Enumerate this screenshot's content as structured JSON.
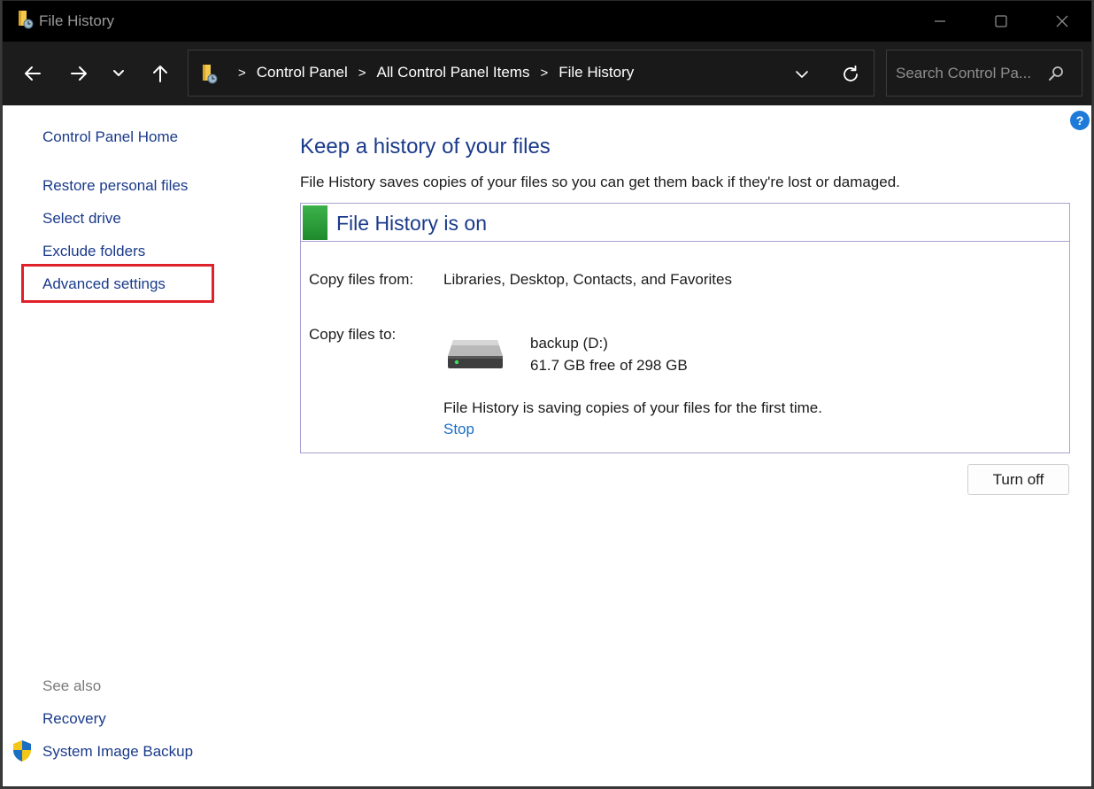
{
  "window": {
    "title": "File History",
    "app_icon": "file-history-folder-icon",
    "controls": [
      "minimize-icon",
      "maximize-icon",
      "close-icon"
    ]
  },
  "nav": {
    "buttons": [
      "back-arrow-icon",
      "forward-arrow-icon",
      "chevron-down-icon",
      "up-arrow-icon"
    ]
  },
  "address": {
    "breadcrumbs": [
      "Control Panel",
      "All Control Panel Items",
      "File History"
    ],
    "separator": ">"
  },
  "search": {
    "placeholder": "Search Control Pa...",
    "value": ""
  },
  "help": {
    "label": "?"
  },
  "sidebar": {
    "home": "Control Panel Home",
    "items": [
      {
        "label": "Restore personal files"
      },
      {
        "label": "Select drive"
      },
      {
        "label": "Exclude folders"
      },
      {
        "label": "Advanced settings"
      }
    ],
    "see_also_heading": "See also",
    "see_also": [
      {
        "label": "Recovery"
      },
      {
        "label": "System Image Backup"
      }
    ]
  },
  "main": {
    "title": "Keep a history of your files",
    "description": "File History saves copies of your files so you can get them back if they're lost or damaged.",
    "status": {
      "title": "File History is on",
      "color": "#2a9d38"
    },
    "copy_from_label": "Copy files from:",
    "copy_from_value": "Libraries, Desktop, Contacts, and Favorites",
    "copy_to_label": "Copy files to:",
    "drive_name": "backup (D:)",
    "drive_space": "61.7 GB free of 298 GB",
    "saving_message": "File History is saving copies of your files for the first time.",
    "stop_label": "Stop",
    "turn_off_label": "Turn off"
  },
  "colors": {
    "link": "#1a3a8a",
    "highlight": "#e0202a",
    "panel_border": "#a7a2d1"
  }
}
